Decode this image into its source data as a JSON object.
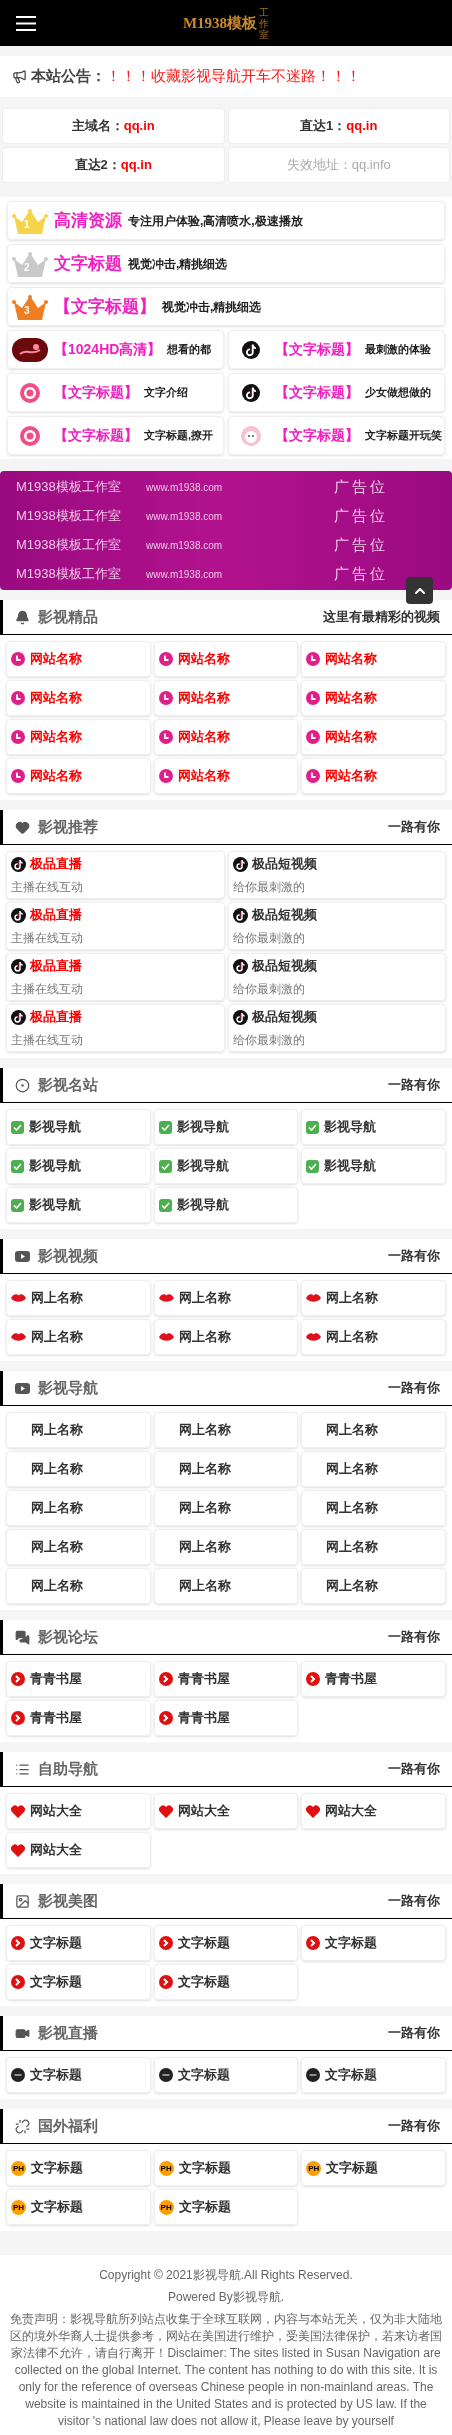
{
  "header": {
    "logo": "M1938模板",
    "logo_small": "工作室"
  },
  "notice": {
    "label": "本站公告：",
    "text": "！！！收藏影视导航开车不迷路！！！"
  },
  "domains": [
    {
      "label": "主域名：",
      "value": "qq.in",
      "disabled": false
    },
    {
      "label": "直达1：",
      "value": "qq.in",
      "disabled": false
    },
    {
      "label": "直达2：",
      "value": "qq.in",
      "disabled": false
    },
    {
      "label": "失效地址：",
      "value": "qq.info",
      "disabled": true
    }
  ],
  "promos": [
    {
      "rank": "1",
      "title": "高清资源",
      "desc": "专注用户体验,高清喷水,极速播放",
      "wide": true
    },
    {
      "rank": "2",
      "title": "文字标题",
      "desc": "视觉冲击,精挑细选",
      "wide": true
    },
    {
      "rank": "3",
      "title": "【文字标题】",
      "desc": "视觉冲击,精挑细选",
      "wide": true
    },
    {
      "title": "【1024HD高清】",
      "desc": "想看的都",
      "wide": false
    },
    {
      "title": "【文字标题】",
      "desc": "最刺激的体验",
      "wide": false
    },
    {
      "title": "【文字标题】",
      "desc": "文字介绍",
      "wide": false
    },
    {
      "title": "【文字标题】",
      "desc": "少女做想做的",
      "wide": false
    },
    {
      "title": "【文字标题】",
      "desc": "文字标题,撩开",
      "wide": false
    },
    {
      "title": "【文字标题】",
      "desc": "文字标题开玩笑",
      "wide": false
    }
  ],
  "banner": [
    {
      "name": "M1938模板工作室",
      "url": "www.m1938.com",
      "tag": "广告位"
    },
    {
      "name": "M1938模板工作室",
      "url": "www.m1938.com",
      "tag": "广告位"
    },
    {
      "name": "M1938模板工作室",
      "url": "www.m1938.com",
      "tag": "广告位"
    },
    {
      "name": "M1938模板工作室",
      "url": "www.m1938.com",
      "tag": "广告位"
    }
  ],
  "sections": [
    {
      "title": "影视精品",
      "subtitle": "这里有最精彩的视频",
      "kind": "grid",
      "items": [
        {
          "label": "网站名称"
        },
        {
          "label": "网站名称"
        },
        {
          "label": "网站名称"
        },
        {
          "label": "网站名称"
        },
        {
          "label": "网站名称"
        },
        {
          "label": "网站名称"
        },
        {
          "label": "网站名称"
        },
        {
          "label": "网站名称"
        },
        {
          "label": "网站名称"
        },
        {
          "label": "网站名称"
        },
        {
          "label": "网站名称"
        },
        {
          "label": "网站名称"
        }
      ]
    },
    {
      "title": "影视推荐",
      "subtitle": "一路有你",
      "kind": "cards",
      "items": [
        {
          "title": "极品直播",
          "desc": "主播在线互动",
          "color": "#ff0000"
        },
        {
          "title": "极品短视频",
          "desc": "给你最刺激的",
          "color": "#333333"
        },
        {
          "title": "极品直播",
          "desc": "主播在线互动",
          "color": "#ff0000"
        },
        {
          "title": "极品短视频",
          "desc": "给你最刺激的",
          "color": "#333333"
        },
        {
          "title": "极品直播",
          "desc": "主播在线互动",
          "color": "#ff0000"
        },
        {
          "title": "极品短视频",
          "desc": "给你最刺激的",
          "color": "#333333"
        },
        {
          "title": "极品直播",
          "desc": "主播在线互动",
          "color": "#ff0000"
        },
        {
          "title": "极品短视频",
          "desc": "给你最刺激的",
          "color": "#333333"
        }
      ]
    },
    {
      "title": "影视名站",
      "subtitle": "一路有你",
      "kind": "grid",
      "items": [
        {
          "label": "影视导航"
        },
        {
          "label": "影视导航"
        },
        {
          "label": "影视导航"
        },
        {
          "label": "影视导航"
        },
        {
          "label": "影视导航"
        },
        {
          "label": "影视导航"
        },
        {
          "label": "影视导航"
        },
        {
          "label": "影视导航"
        }
      ]
    },
    {
      "title": "影视视频",
      "subtitle": "一路有你",
      "kind": "grid",
      "items": [
        {
          "label": "网上名称"
        },
        {
          "label": "网上名称"
        },
        {
          "label": "网上名称"
        },
        {
          "label": "网上名称"
        },
        {
          "label": "网上名称"
        },
        {
          "label": "网上名称"
        }
      ]
    },
    {
      "title": "影视导航",
      "subtitle": "一路有你",
      "kind": "plain",
      "items": [
        {
          "label": "网上名称"
        },
        {
          "label": "网上名称"
        },
        {
          "label": "网上名称"
        },
        {
          "label": "网上名称"
        },
        {
          "label": "网上名称"
        },
        {
          "label": "网上名称"
        },
        {
          "label": "网上名称"
        },
        {
          "label": "网上名称"
        },
        {
          "label": "网上名称"
        },
        {
          "label": "网上名称"
        },
        {
          "label": "网上名称"
        },
        {
          "label": "网上名称"
        },
        {
          "label": "网上名称"
        },
        {
          "label": "网上名称"
        },
        {
          "label": "网上名称"
        }
      ]
    },
    {
      "title": "影视论坛",
      "subtitle": "一路有你",
      "kind": "grid",
      "items": [
        {
          "label": "青青书屋"
        },
        {
          "label": "青青书屋"
        },
        {
          "label": "青青书屋"
        },
        {
          "label": "青青书屋"
        },
        {
          "label": "青青书屋"
        }
      ]
    },
    {
      "title": "自助导航",
      "subtitle": "一路有你",
      "kind": "grid",
      "items": [
        {
          "label": "网站大全"
        },
        {
          "label": "网站大全"
        },
        {
          "label": "网站大全"
        },
        {
          "label": "网站大全"
        }
      ]
    },
    {
      "title": "影视美图",
      "subtitle": "一路有你",
      "kind": "grid",
      "items": [
        {
          "label": "文字标题"
        },
        {
          "label": "文字标题"
        },
        {
          "label": "文字标题"
        },
        {
          "label": "文字标题"
        },
        {
          "label": "文字标题"
        }
      ]
    },
    {
      "title": "影视直播",
      "subtitle": "一路有你",
      "kind": "grid",
      "items": [
        {
          "label": "文字标题"
        },
        {
          "label": "文字标题"
        },
        {
          "label": "文字标题"
        }
      ]
    },
    {
      "title": "国外福利",
      "subtitle": "一路有你",
      "kind": "grid",
      "items": [
        {
          "label": "文字标题",
          "badge": "PH"
        },
        {
          "label": "文字标题",
          "badge": "PH"
        },
        {
          "label": "文字标题",
          "badge": "PH"
        },
        {
          "label": "文字标题",
          "badge": "PH"
        },
        {
          "label": "文字标题",
          "badge": "PH"
        }
      ]
    }
  ],
  "footer": {
    "copyright": "Copyright © 2021影视导航.All Rights Reserved.",
    "powered": "Powered By影视导航.",
    "disclaimer": "免责声明：影视导航所列站点收集于全球互联网，内容与本站无关，仅为非大陆地区的境外华裔人士提供参考，网站在美国进行维护，受美国法律保护，若来访者国家法律不允许，请自行离开！Disclaimer: The sites listed in Susan Navigation are collected on the global Internet. The content has nothing to do with this site. It is only for the reference of overseas Chinese people in non-mainland areas. The website is maintained in the United States and is protected by US law. If the visitor 's national law does not allow it, Please leave by yourself"
  }
}
